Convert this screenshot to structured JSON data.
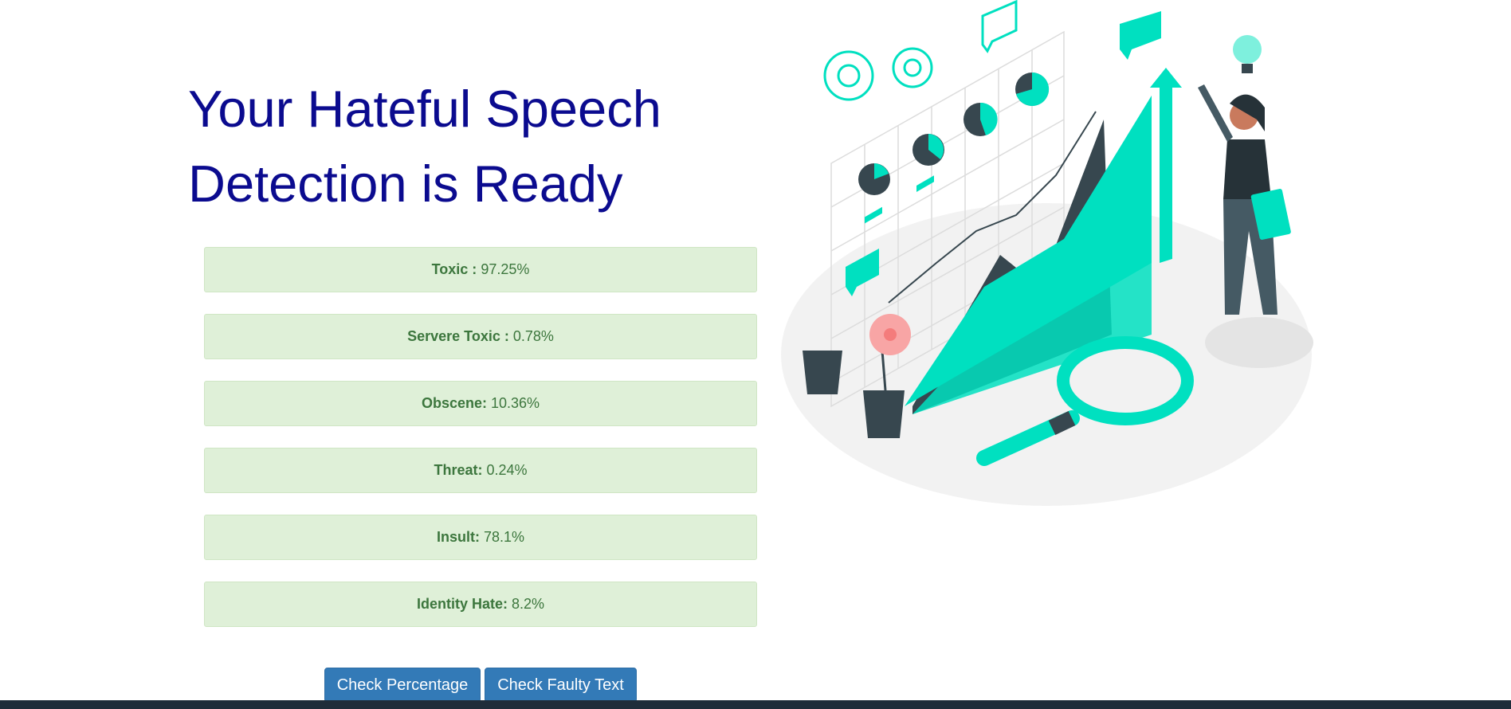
{
  "heading": {
    "line1": "Your Hateful Speech",
    "line2": "Detection is Ready"
  },
  "results": [
    {
      "label": "Toxic : ",
      "value": "97.25%"
    },
    {
      "label": "Servere Toxic : ",
      "value": "0.78%"
    },
    {
      "label": "Obscene: ",
      "value": "10.36%"
    },
    {
      "label": "Threat: ",
      "value": "0.24%"
    },
    {
      "label": "Insult: ",
      "value": "78.1%"
    },
    {
      "label": "Identity Hate: ",
      "value": "8.2%"
    }
  ],
  "buttons": {
    "check_percentage": "Check Percentage",
    "check_faulty_text": "Check Faulty Text"
  },
  "colors": {
    "heading": "#0b0b8f",
    "alert_bg": "#dff0d8",
    "alert_text": "#3c763d",
    "button": "#337ab7",
    "accent_teal": "#00e0c0",
    "footer": "#1f2d3a"
  },
  "illustration": {
    "icon": "data-analysis-illustration"
  }
}
